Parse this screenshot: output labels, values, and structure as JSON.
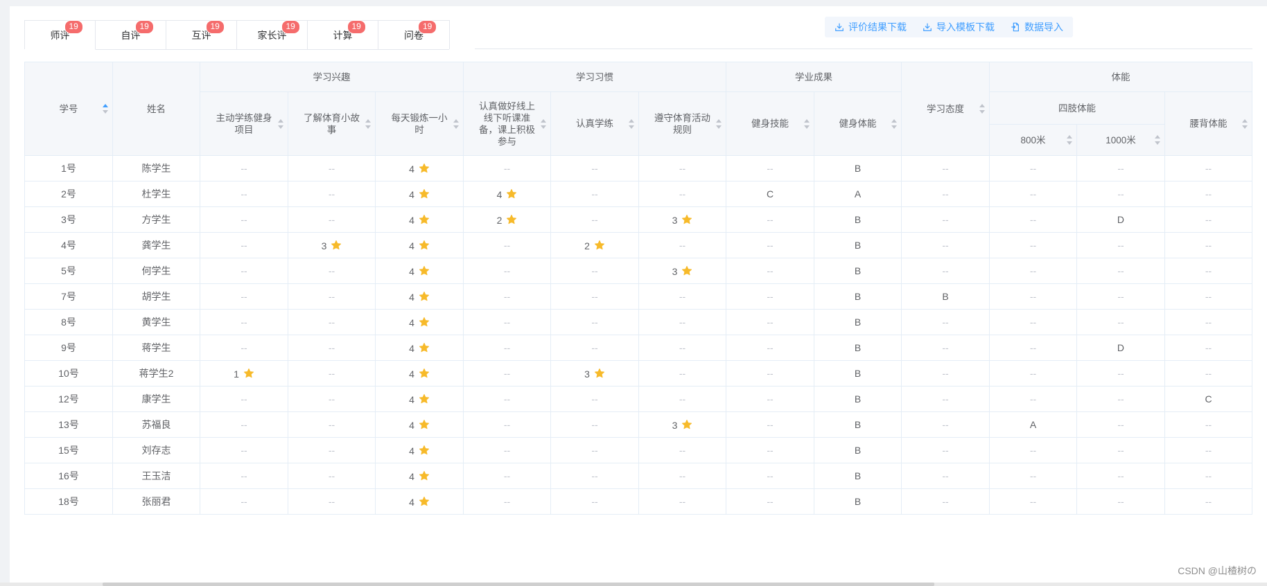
{
  "tabs": [
    {
      "label": "师评",
      "badge": "19"
    },
    {
      "label": "自评",
      "badge": "19"
    },
    {
      "label": "互评",
      "badge": "19"
    },
    {
      "label": "家长评",
      "badge": "19"
    },
    {
      "label": "计算",
      "badge": "19"
    },
    {
      "label": "问卷",
      "badge": "19"
    }
  ],
  "actions": {
    "download_results": "评价结果下载",
    "download_template": "导入模板下载",
    "import_data": "数据导入"
  },
  "header": {
    "student_no": "学号",
    "name": "姓名",
    "group_interest": "学习兴趣",
    "group_habit": "学习习惯",
    "group_achievement": "学业成果",
    "attitude": "学习态度",
    "group_fitness": "体能",
    "group_limb": "四肢体能",
    "col_active_practice": "主动学练健身项目",
    "col_pe_stories": "了解体育小故事",
    "col_daily_exercise": "每天锻炼一小时",
    "col_listen_class": "认真做好线上线下听课准备，课上积极参与",
    "col_serious_practice": "认真学练",
    "col_rules": "遵守体育活动规则",
    "col_skill": "健身技能",
    "col_fitness": "健身体能",
    "col_800m": "800米",
    "col_1000m": "1000米",
    "col_waist": "腰背体能"
  },
  "icons": {
    "star": "star-icon",
    "download": "download-icon",
    "import": "import-file-icon"
  },
  "colors": {
    "accent": "#409eff",
    "badge": "#f56c6c",
    "star": "#f7ba2a"
  },
  "rows": [
    {
      "no": "1号",
      "name": "陈学生",
      "c": [
        "--",
        "--",
        "4",
        "--",
        "--",
        "--",
        "--",
        "B",
        "--",
        "--",
        "--",
        "--"
      ]
    },
    {
      "no": "2号",
      "name": "杜学生",
      "c": [
        "--",
        "--",
        "4",
        "4",
        "--",
        "--",
        "C",
        "A",
        "--",
        "--",
        "--",
        "--"
      ]
    },
    {
      "no": "3号",
      "name": "方学生",
      "c": [
        "--",
        "--",
        "4",
        "2",
        "--",
        "3",
        "--",
        "B",
        "--",
        "--",
        "D",
        "--"
      ]
    },
    {
      "no": "4号",
      "name": "龚学生",
      "c": [
        "--",
        "3",
        "4",
        "--",
        "2",
        "--",
        "--",
        "B",
        "--",
        "--",
        "--",
        "--"
      ]
    },
    {
      "no": "5号",
      "name": "何学生",
      "c": [
        "--",
        "--",
        "4",
        "--",
        "--",
        "3",
        "--",
        "B",
        "--",
        "--",
        "--",
        "--"
      ]
    },
    {
      "no": "7号",
      "name": "胡学生",
      "c": [
        "--",
        "--",
        "4",
        "--",
        "--",
        "--",
        "--",
        "B",
        "B",
        "--",
        "--",
        "--"
      ]
    },
    {
      "no": "8号",
      "name": "黄学生",
      "c": [
        "--",
        "--",
        "4",
        "--",
        "--",
        "--",
        "--",
        "B",
        "--",
        "--",
        "--",
        "--"
      ]
    },
    {
      "no": "9号",
      "name": "蒋学生",
      "c": [
        "--",
        "--",
        "4",
        "--",
        "--",
        "--",
        "--",
        "B",
        "--",
        "--",
        "D",
        "--"
      ]
    },
    {
      "no": "10号",
      "name": "蒋学生2",
      "c": [
        "1",
        "--",
        "4",
        "--",
        "3",
        "--",
        "--",
        "B",
        "--",
        "--",
        "--",
        "--"
      ]
    },
    {
      "no": "12号",
      "name": "康学生",
      "c": [
        "--",
        "--",
        "4",
        "--",
        "--",
        "--",
        "--",
        "B",
        "--",
        "--",
        "--",
        "C"
      ]
    },
    {
      "no": "13号",
      "name": "苏福良",
      "c": [
        "--",
        "--",
        "4",
        "--",
        "--",
        "3",
        "--",
        "B",
        "--",
        "A",
        "--",
        "--"
      ]
    },
    {
      "no": "15号",
      "name": "刘存志",
      "c": [
        "--",
        "--",
        "4",
        "--",
        "--",
        "--",
        "--",
        "B",
        "--",
        "--",
        "--",
        "--"
      ]
    },
    {
      "no": "16号",
      "name": "王玉洁",
      "c": [
        "--",
        "--",
        "4",
        "--",
        "--",
        "--",
        "--",
        "B",
        "--",
        "--",
        "--",
        "--"
      ]
    },
    {
      "no": "18号",
      "name": "张丽君",
      "c": [
        "--",
        "--",
        "4",
        "--",
        "--",
        "--",
        "--",
        "B",
        "--",
        "--",
        "--",
        "--"
      ]
    }
  ],
  "star_columns": [
    0,
    1,
    2,
    3,
    4,
    5
  ],
  "watermark": "CSDN @山楂树の"
}
